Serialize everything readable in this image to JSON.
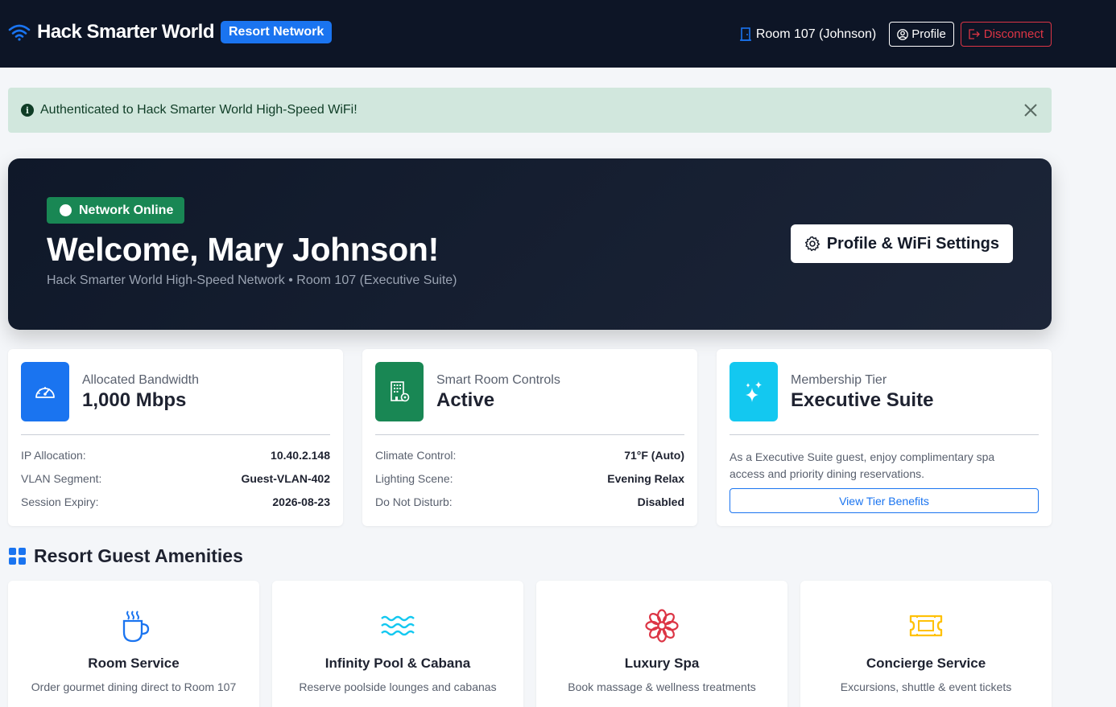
{
  "navbar": {
    "brand_name": "Hack Smarter World",
    "brand_badge": "Resort Network",
    "room_label": "Room 107 (Johnson)",
    "profile_label": "Profile",
    "disconnect_label": "Disconnect"
  },
  "alert": {
    "message": "Authenticated to Hack Smarter World High-Speed WiFi!",
    "icon": "info-icon"
  },
  "hero": {
    "status": "Network Online",
    "title": "Welcome, Mary Johnson!",
    "subtitle": "Hack Smarter World High-Speed Network • Room 107 (Executive Suite)",
    "settings_button": "Profile & WiFi Settings"
  },
  "cards": [
    {
      "label": "Allocated Bandwidth",
      "value": "1,000 Mbps",
      "icon": "speedometer-icon",
      "color": "#1a74f0",
      "rows": [
        {
          "key": "IP Allocation:",
          "val": "10.40.2.148"
        },
        {
          "key": "VLAN Segment:",
          "val": "Guest-VLAN-402"
        },
        {
          "key": "Session Expiry:",
          "val": "2026-08-23"
        }
      ]
    },
    {
      "label": "Smart Room Controls",
      "value": "Active",
      "icon": "building-gear-icon",
      "color": "#198754",
      "rows": [
        {
          "key": "Climate Control:",
          "val": "71°F (Auto)"
        },
        {
          "key": "Lighting Scene:",
          "val": "Evening Relax"
        },
        {
          "key": "Do Not Disturb:",
          "val": "Disabled"
        }
      ]
    },
    {
      "label": "Membership Tier",
      "value": "Executive Suite",
      "icon": "stars-icon",
      "color": "#13c8f0",
      "description": "As a Executive Suite guest, enjoy complimentary spa access and priority dining reservations.",
      "button": "View Tier Benefits"
    }
  ],
  "amenities": {
    "title": "Resort Guest Amenities",
    "items": [
      {
        "title": "Room Service",
        "desc": "Order gourmet dining direct to Room 107",
        "icon": "hot-cup-icon",
        "color": "#1a74f0"
      },
      {
        "title": "Infinity Pool & Cabana",
        "desc": "Reserve poolside lounges and cabanas",
        "icon": "water-waves-icon",
        "color": "#13c8f0"
      },
      {
        "title": "Luxury Spa",
        "desc": "Book massage & wellness treatments",
        "icon": "flower-icon",
        "color": "#dc3545"
      },
      {
        "title": "Concierge Service",
        "desc": "Excursions, shuttle & event tickets",
        "icon": "ticket-icon",
        "color": "#ffc107"
      }
    ]
  }
}
